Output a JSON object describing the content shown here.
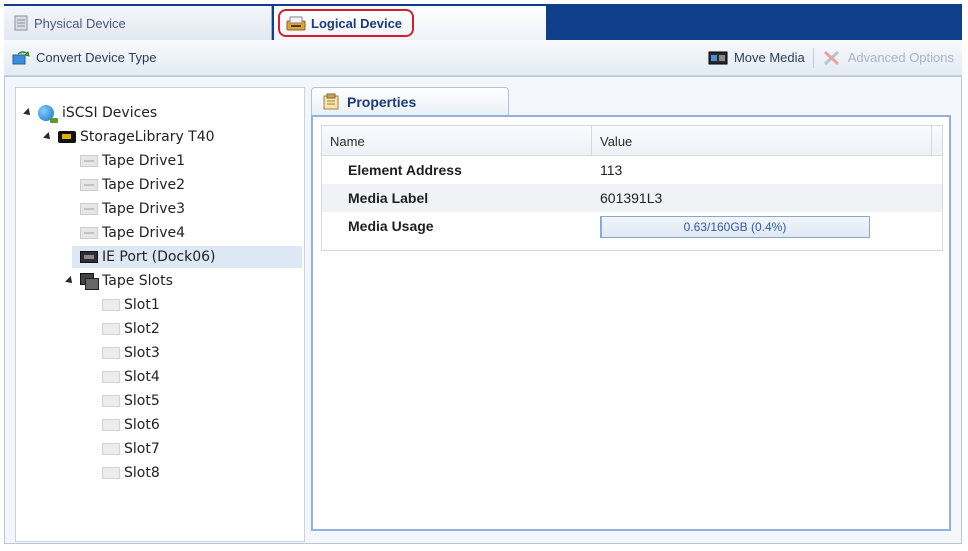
{
  "tabs": {
    "physical_label": "Physical Device",
    "logical_label": "Logical Device"
  },
  "toolbar": {
    "convert_label": "Convert Device Type",
    "move_media_label": "Move Media",
    "advanced_options_label": "Advanced Options"
  },
  "tree": {
    "root": "iSCSI Devices",
    "library": "StorageLibrary T40",
    "drives": [
      "Tape Drive1",
      "Tape Drive2",
      "Tape Drive3",
      "Tape Drive4"
    ],
    "ie_port": "IE Port (Dock06)",
    "slots_group": "Tape Slots",
    "slots": [
      "Slot1",
      "Slot2",
      "Slot3",
      "Slot4",
      "Slot5",
      "Slot6",
      "Slot7",
      "Slot8"
    ]
  },
  "properties": {
    "tab_label": "Properties",
    "col_name": "Name",
    "col_value": "Value",
    "rows": [
      {
        "name": "Element Address",
        "value": "113"
      },
      {
        "name": "Media Label",
        "value": "601391L3"
      },
      {
        "name": "Media Usage",
        "value": "0.63/160GB (0.4%)"
      }
    ],
    "media_usage_fraction": 0.004
  },
  "colors": {
    "tabbar_bg": "#0f3f8a",
    "highlight_outline": "#d0202f",
    "selection_bg": "#dde8f5"
  }
}
